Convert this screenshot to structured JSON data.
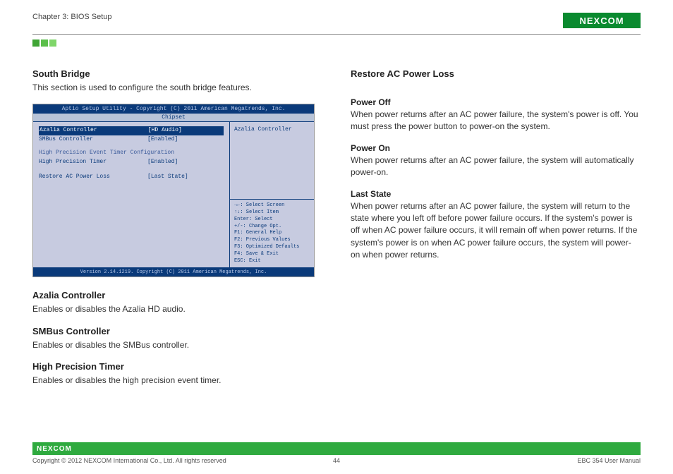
{
  "header": {
    "chapter": "Chapter 3: BIOS Setup",
    "logo_text": "NEXCOM"
  },
  "left_column": {
    "south_bridge": {
      "heading": "South Bridge",
      "text": "This section is used to configure the south bridge features."
    },
    "azalia": {
      "heading": "Azalia Controller",
      "text": "Enables or disables the Azalia HD audio."
    },
    "smbus": {
      "heading": "SMBus Controller",
      "text": "Enables or disables the SMBus controller."
    },
    "hpt": {
      "heading": "High Precision Timer",
      "text": "Enables or disables the high precision event timer."
    }
  },
  "right_column": {
    "restore": {
      "heading": "Restore AC Power Loss",
      "power_off": {
        "heading": "Power Off",
        "text": "When power returns after an AC power failure, the system's power is off. You must press the power button to power-on the system."
      },
      "power_on": {
        "heading": "Power On",
        "text": "When power returns after an AC power failure, the system will automatically power-on."
      },
      "last_state": {
        "heading": "Last State",
        "text": "When power returns after an AC power failure, the system will return to the state where you left off before power failure occurs. If the system's power is off when AC power failure occurs, it will remain off when power returns. If the system's power is on when AC power failure occurs, the system will power-on when power returns."
      }
    }
  },
  "bios": {
    "title": "Aptio Setup Utility - Copyright (C) 2011 American Megatrends, Inc.",
    "tab": "Chipset",
    "rows": {
      "azalia_k": "Azalia Controller",
      "azalia_v": "[HD Audio]",
      "smbus_k": "SMBus Controller",
      "smbus_v": "[Enabled]",
      "group": "High Precision Event Timer Configuration",
      "hpt_k": "High Precision Timer",
      "hpt_v": "[Enabled]",
      "restore_k": "Restore AC Power Loss",
      "restore_v": "[Last State]"
    },
    "right_top": "Azalia Controller",
    "help": {
      "l1": "→←: Select Screen",
      "l2": "↑↓: Select Item",
      "l3": "Enter: Select",
      "l4": "+/-: Change Opt.",
      "l5": "F1: General Help",
      "l6": "F2: Previous Values",
      "l7": "F3: Optimized Defaults",
      "l8": "F4: Save & Exit",
      "l9": "ESC: Exit"
    },
    "footer": "Version 2.14.1219. Copyright (C) 2011 American Megatrends, Inc."
  },
  "footer": {
    "logo": "NEXCOM",
    "copyright": "Copyright © 2012 NEXCOM International Co., Ltd. All rights reserved",
    "page": "44",
    "doc": "EBC 354 User Manual"
  }
}
